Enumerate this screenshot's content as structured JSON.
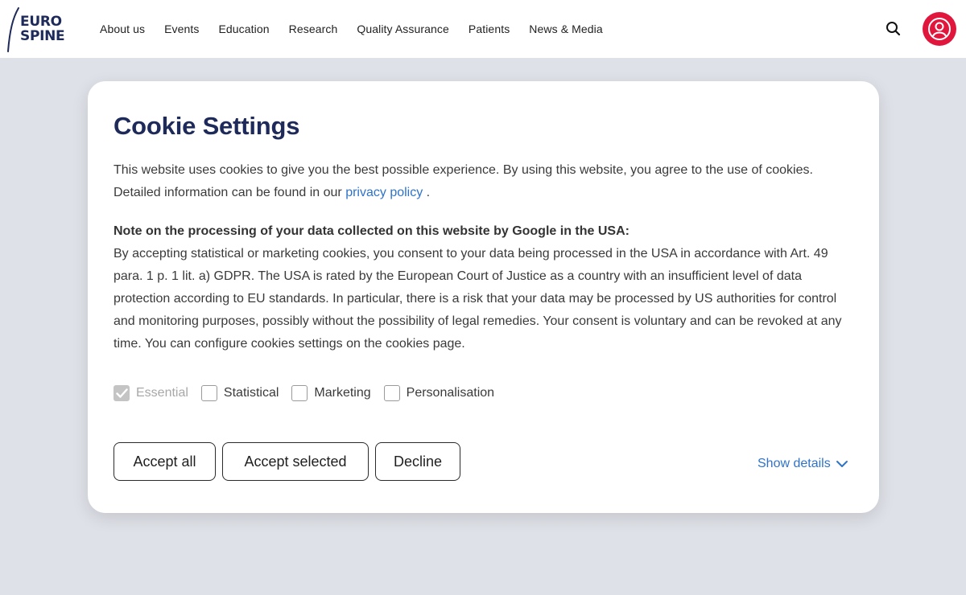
{
  "header": {
    "logo_line1": "EURO",
    "logo_line2": "SPINE",
    "nav": [
      "About us",
      "Events",
      "Education",
      "Research",
      "Quality Assurance",
      "Patients",
      "News & Media"
    ]
  },
  "modal": {
    "title": "Cookie Settings",
    "intro_text": "This website uses cookies to give you the best possible experience. By using this website, you agree to the use of cookies. Detailed information can be found in our",
    "privacy_link": "privacy policy",
    "intro_end": ".",
    "note_heading": "Note on the processing of your data collected on this website by Google in the USA:",
    "note_body": "By accepting statistical or marketing cookies, you consent to your data being processed in the USA in accordance with Art. 49 para. 1 p. 1 lit. a) GDPR. The USA is rated by the European Court of Justice as a country with an insufficient level of data protection according to EU standards. In particular, there is a risk that your data may be processed by US authorities for control and monitoring purposes, possibly without the possibility of legal remedies. Your consent is voluntary and can be revoked at any time. You can configure cookies settings on the cookies page.",
    "checkboxes": [
      {
        "label": "Essential",
        "checked": true,
        "disabled": true
      },
      {
        "label": "Statistical",
        "checked": false,
        "disabled": false
      },
      {
        "label": "Marketing",
        "checked": false,
        "disabled": false
      },
      {
        "label": "Personalisation",
        "checked": false,
        "disabled": false
      }
    ],
    "buttons": {
      "accept_all": "Accept all",
      "accept_selected": "Accept selected",
      "decline": "Decline"
    },
    "show_details": "Show details"
  },
  "colors": {
    "brand_navy": "#1e2a5a",
    "accent_red": "#e0163d",
    "link_blue": "#2f73c9",
    "page_bg": "#dfe1e8"
  },
  "icons": [
    "search-icon",
    "user-icon",
    "checkmark-icon",
    "chevron-down-icon"
  ]
}
